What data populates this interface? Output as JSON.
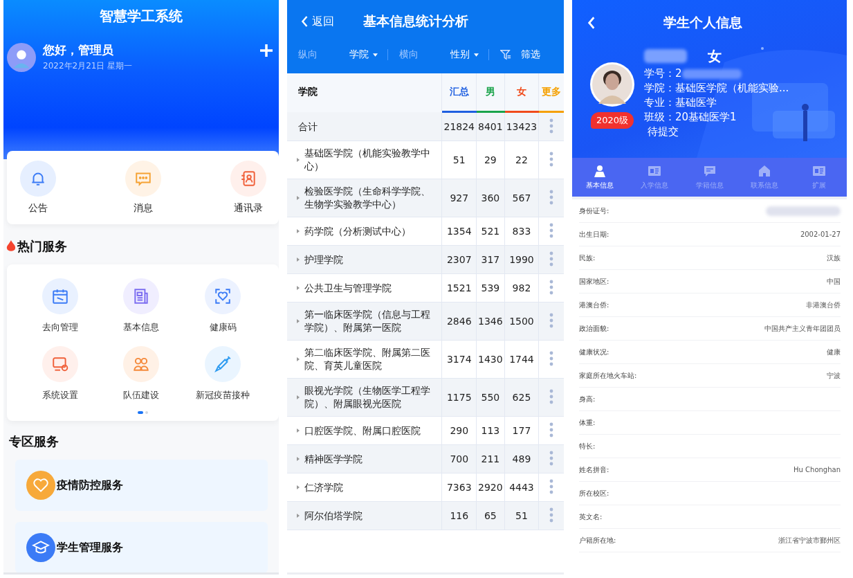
{
  "home": {
    "title": "智慧学工系统",
    "greeting": "您好，管理员",
    "date": "2022年2月21日 星期一",
    "quick_actions": [
      {
        "label": "公告",
        "kind": "bell"
      },
      {
        "label": "消息",
        "kind": "chat"
      },
      {
        "label": "通讯录",
        "kind": "contacts"
      }
    ],
    "hot_services": {
      "title": "热门服务",
      "items": [
        {
          "label": "去向管理",
          "kind": "calendar"
        },
        {
          "label": "基本信息",
          "kind": "document"
        },
        {
          "label": "健康码",
          "kind": "health"
        },
        {
          "label": "系统设置",
          "kind": "settings"
        },
        {
          "label": "队伍建设",
          "kind": "team"
        },
        {
          "label": "新冠疫苗接种",
          "kind": "syringe"
        }
      ],
      "pages": [
        {
          "selected": true
        },
        {
          "selected": false
        }
      ]
    },
    "zone_services": {
      "title": "专区服务",
      "items": [
        {
          "label": "疫情防控服务",
          "kind": "heart"
        },
        {
          "label": "学生管理服务",
          "kind": "cap"
        }
      ]
    }
  },
  "stats": {
    "back": "返回",
    "title": "基本信息统计分析",
    "filters": [
      {
        "kind": "label",
        "label": "纵向"
      },
      {
        "kind": "select",
        "label": "学院"
      },
      {
        "kind": "label",
        "label": "横向"
      },
      {
        "kind": "select",
        "label": "性别"
      },
      {
        "kind": "filter",
        "label": "筛选"
      }
    ],
    "table": {
      "columns": [
        {
          "label": "学院"
        },
        {
          "label": "汇总",
          "color": "#1f5fe0"
        },
        {
          "label": "男",
          "color": "#1aa34a"
        },
        {
          "label": "女",
          "color": "#f04a1a"
        },
        {
          "label": "更多",
          "color": "#f5a000"
        }
      ],
      "rows": [
        {
          "kind": "total",
          "name": "合计",
          "total": "21824",
          "male": "8401",
          "female": "13423"
        },
        {
          "kind": "college",
          "name": "基础医学院（机能实验教学中心）",
          "total": "51",
          "male": "29",
          "female": "22"
        },
        {
          "kind": "college",
          "name": "检验医学院（生命科学学院、生物学实验教学中心）",
          "total": "927",
          "male": "360",
          "female": "567"
        },
        {
          "kind": "college",
          "name": "药学院（分析测试中心）",
          "total": "1354",
          "male": "521",
          "female": "833"
        },
        {
          "kind": "college",
          "name": "护理学院",
          "total": "2307",
          "male": "317",
          "female": "1990"
        },
        {
          "kind": "college",
          "name": "公共卫生与管理学院",
          "total": "1521",
          "male": "539",
          "female": "982"
        },
        {
          "kind": "college",
          "name": "第一临床医学院（信息与工程学院）、附属第一医院",
          "total": "2846",
          "male": "1346",
          "female": "1500"
        },
        {
          "kind": "college",
          "name": "第二临床医学院、附属第二医院、育英儿童医院",
          "total": "3174",
          "male": "1430",
          "female": "1744"
        },
        {
          "kind": "college",
          "name": "眼视光学院（生物医学工程学院）、附属眼视光医院",
          "total": "1175",
          "male": "550",
          "female": "625"
        },
        {
          "kind": "college",
          "name": "口腔医学院、附属口腔医院",
          "total": "290",
          "male": "113",
          "female": "177"
        },
        {
          "kind": "college",
          "name": "精神医学学院",
          "total": "700",
          "male": "211",
          "female": "489"
        },
        {
          "kind": "college",
          "name": "仁济学院",
          "total": "7363",
          "male": "2920",
          "female": "4443"
        },
        {
          "kind": "college",
          "name": "阿尔伯塔学院",
          "total": "116",
          "male": "65",
          "female": "51"
        }
      ]
    }
  },
  "student": {
    "title": "学生个人信息",
    "gender": "女",
    "grade": "2020级",
    "details": [
      {
        "text": "学号：2",
        "redacted": true
      },
      {
        "text": "学院：基础医学院（机能实验...",
        "redacted": false
      },
      {
        "text": "专业：基础医学",
        "redacted": false
      },
      {
        "text": "班级：20基础医学1",
        "redacted": false
      }
    ],
    "status": "待提交",
    "tabs": [
      {
        "label": "基本信息",
        "kind": "person",
        "selected": true
      },
      {
        "label": "入学信息",
        "kind": "card",
        "selected": false
      },
      {
        "label": "学籍信息",
        "kind": "chat",
        "selected": false
      },
      {
        "label": "联系信息",
        "kind": "home",
        "selected": false
      },
      {
        "label": "扩展",
        "kind": "card",
        "selected": false
      }
    ],
    "fields": [
      {
        "label": "身份证号:",
        "redacted": true
      },
      {
        "label": "出生日期:",
        "value": "2002-01-27"
      },
      {
        "label": "民族:",
        "value": "汉族"
      },
      {
        "label": "国家地区:",
        "value": "中国"
      },
      {
        "label": "港澳台侨:",
        "value": "非港澳台侨"
      },
      {
        "label": "政治面貌:",
        "value": "中国共产主义青年团团员"
      },
      {
        "label": "健康状况:",
        "value": "健康"
      },
      {
        "label": "家庭所在地火车站:",
        "value": "宁波"
      },
      {
        "label": "身高:"
      },
      {
        "label": "体重:"
      },
      {
        "label": "特长:"
      },
      {
        "label": "姓名拼音:",
        "value": "Hu Chonghan"
      },
      {
        "label": "所在校区:"
      },
      {
        "label": "英文名:"
      },
      {
        "label": "户籍所在地:",
        "value": "浙江省宁波市鄞州区"
      }
    ]
  }
}
